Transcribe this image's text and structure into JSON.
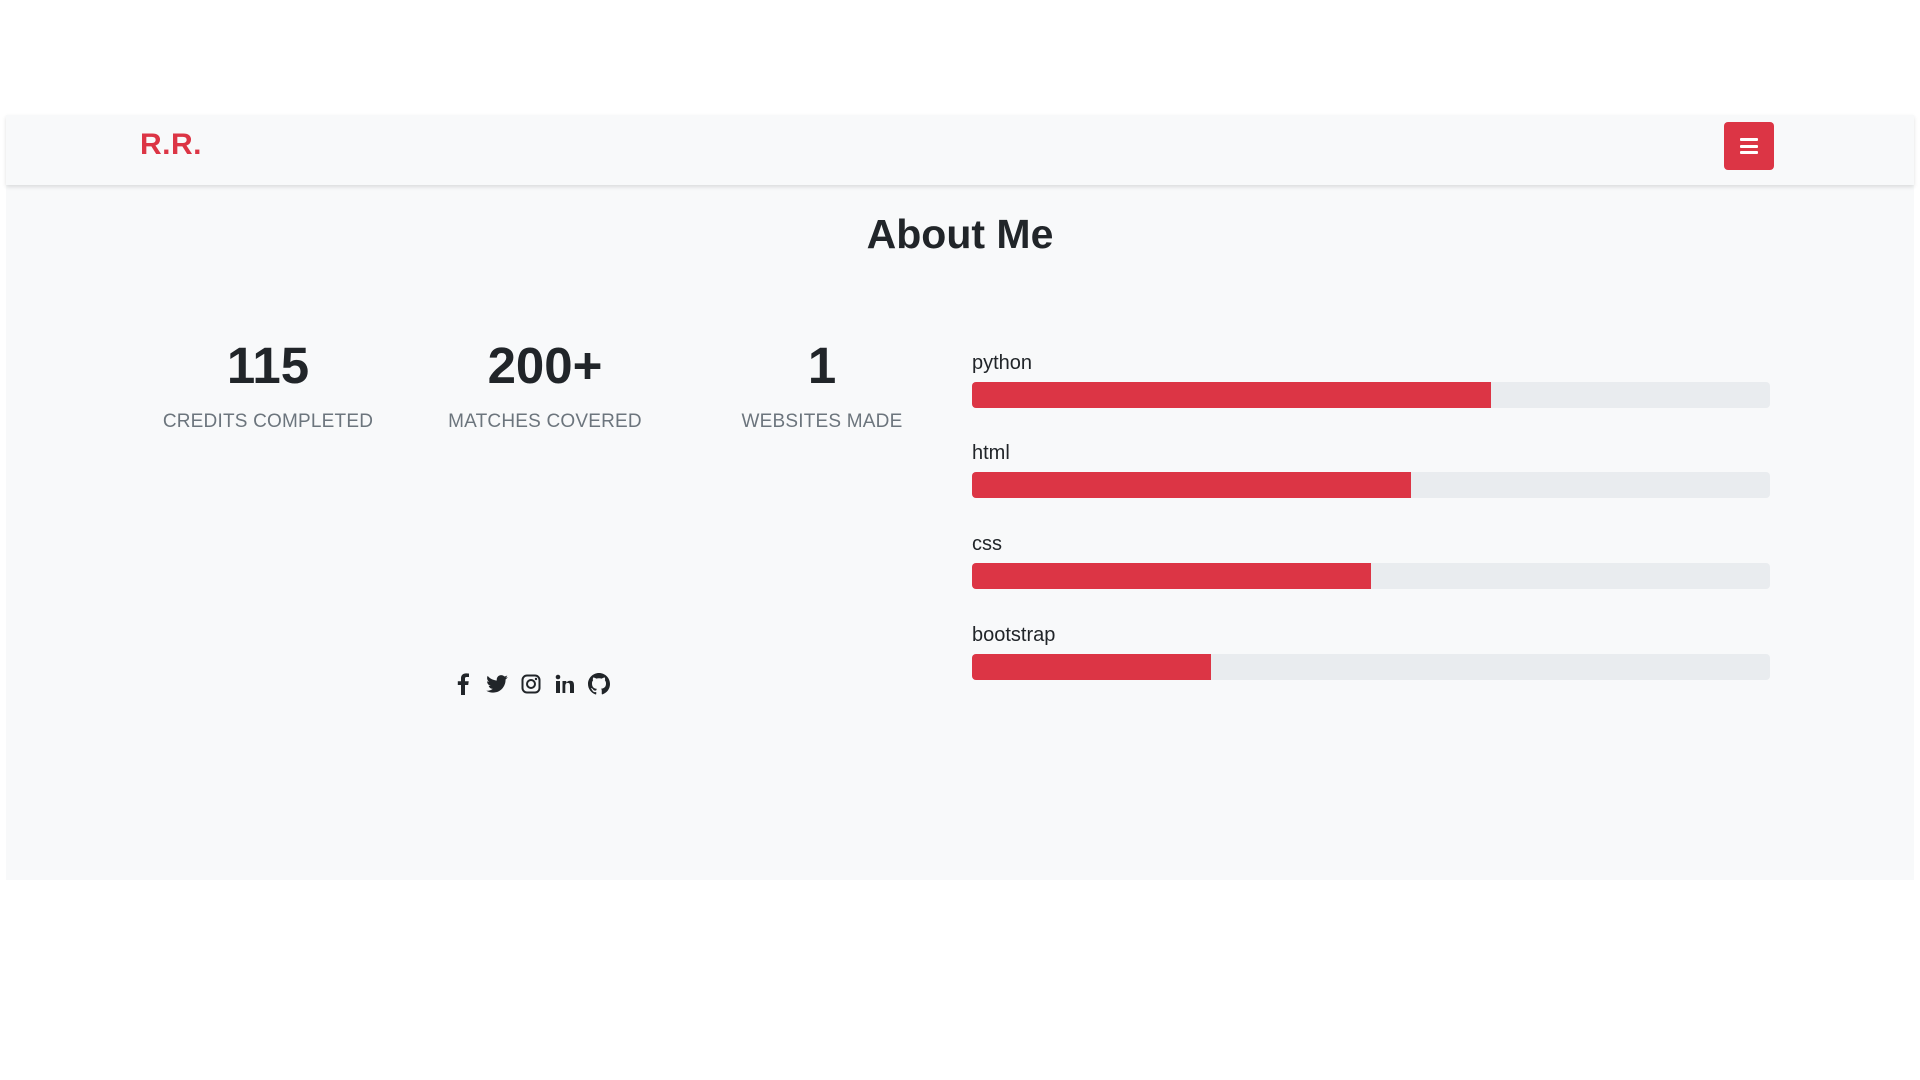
{
  "brand": "R.R.",
  "menu_button_icon": "hamburger-icon",
  "section_title": "About Me",
  "stats": [
    {
      "number": "115",
      "label": "CREDITS COMPLETED"
    },
    {
      "number": "200+",
      "label": "MATCHES COVERED"
    },
    {
      "number": "1",
      "label": "WEBSITES MADE"
    }
  ],
  "social_icons": [
    "facebook-icon",
    "twitter-icon",
    "instagram-icon",
    "linkedin-icon",
    "github-icon"
  ],
  "skills": [
    {
      "name": "python",
      "level_percent": 65
    },
    {
      "name": "html",
      "level_percent": 55
    },
    {
      "name": "css",
      "level_percent": 50
    },
    {
      "name": "bootstrap",
      "level_percent": 30
    }
  ],
  "colors": {
    "accent": "#dc3545",
    "background": "#f8f9fa",
    "track": "#e9ecef",
    "text": "#212529",
    "muted": "#6c757d"
  }
}
